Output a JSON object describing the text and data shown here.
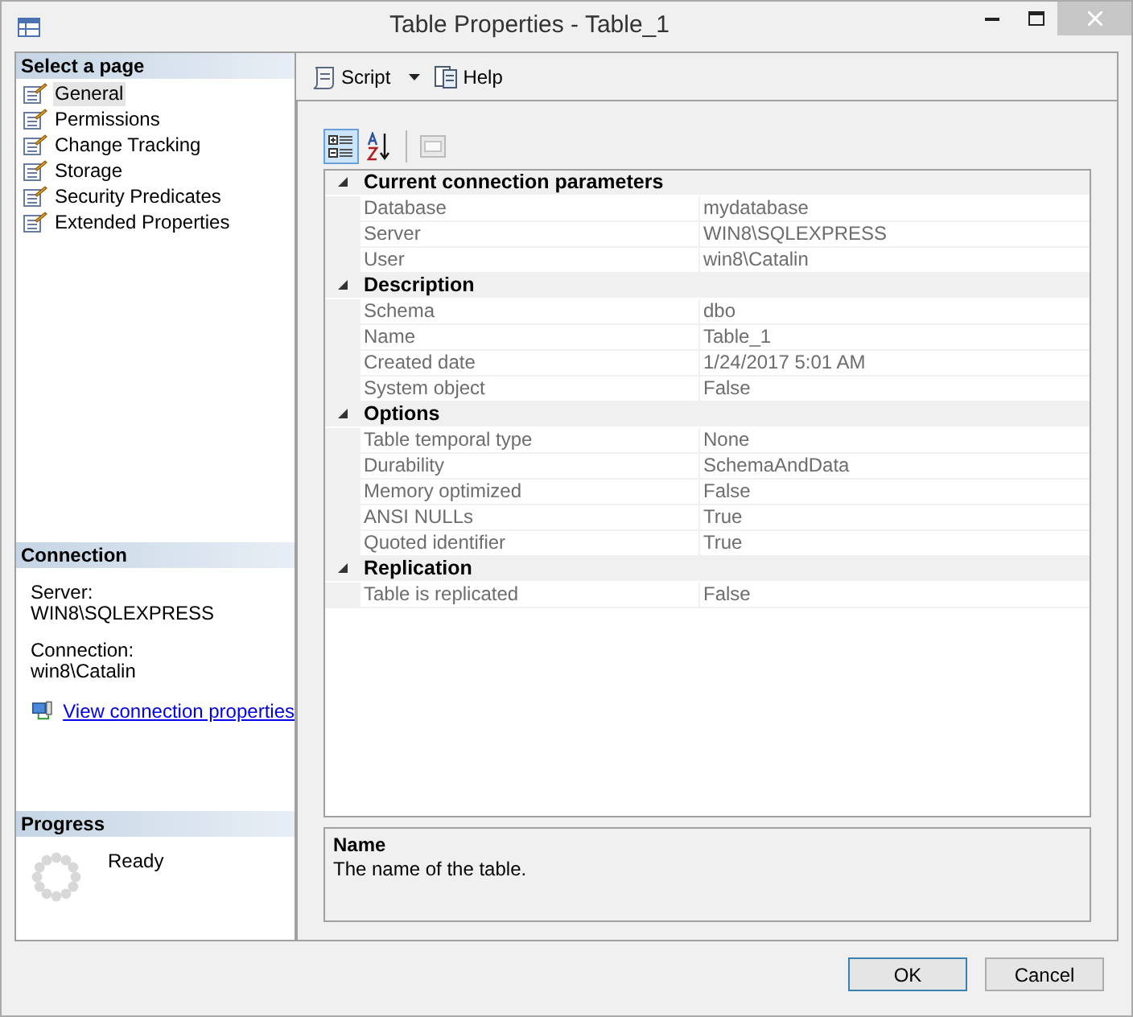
{
  "window": {
    "title": "Table Properties - Table_1"
  },
  "select_page": {
    "header": "Select a page",
    "items": [
      {
        "label": "General",
        "selected": true
      },
      {
        "label": "Permissions",
        "selected": false
      },
      {
        "label": "Change Tracking",
        "selected": false
      },
      {
        "label": "Storage",
        "selected": false
      },
      {
        "label": "Security Predicates",
        "selected": false
      },
      {
        "label": "Extended Properties",
        "selected": false
      }
    ]
  },
  "connection": {
    "header": "Connection",
    "server_label": "Server:",
    "server": "WIN8\\SQLEXPRESS",
    "connection_label": "Connection:",
    "connection": "win8\\Catalin",
    "link": "View connection properties"
  },
  "progress": {
    "header": "Progress",
    "status": "Ready"
  },
  "toolbar": {
    "script": "Script",
    "help": "Help"
  },
  "grid_toolbar": {
    "categorized_selected": true,
    "alphabetical_selected": false
  },
  "property_grid": [
    {
      "category": "Current connection parameters",
      "expanded": true,
      "rows": [
        {
          "name": "Database",
          "value": "mydatabase"
        },
        {
          "name": "Server",
          "value": "WIN8\\SQLEXPRESS"
        },
        {
          "name": "User",
          "value": "win8\\Catalin"
        }
      ]
    },
    {
      "category": "Description",
      "expanded": true,
      "rows": [
        {
          "name": "Schema",
          "value": "dbo"
        },
        {
          "name": "Name",
          "value": "Table_1"
        },
        {
          "name": "Created date",
          "value": "1/24/2017 5:01 AM"
        },
        {
          "name": "System object",
          "value": "False"
        }
      ]
    },
    {
      "category": "Options",
      "expanded": true,
      "rows": [
        {
          "name": "Table temporal type",
          "value": "None"
        },
        {
          "name": "Durability",
          "value": "SchemaAndData"
        },
        {
          "name": "Memory optimized",
          "value": "False"
        },
        {
          "name": "ANSI NULLs",
          "value": "True"
        },
        {
          "name": "Quoted identifier",
          "value": "True"
        }
      ]
    },
    {
      "category": "Replication",
      "expanded": true,
      "rows": [
        {
          "name": "Table is replicated",
          "value": "False"
        }
      ]
    }
  ],
  "description_pane": {
    "title": "Name",
    "text": "The name of the table."
  },
  "buttons": [
    {
      "label": "OK",
      "default": true
    },
    {
      "label": "Cancel",
      "default": false
    }
  ]
}
